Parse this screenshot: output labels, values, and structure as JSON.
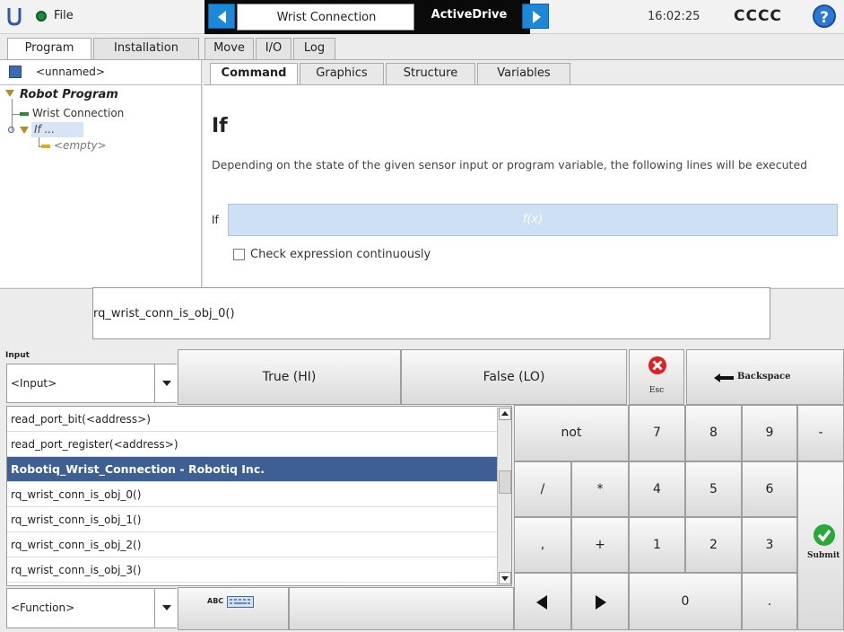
{
  "topbar": {
    "logo_icon": "ur-logo-icon",
    "file_label": "File",
    "nav_program_name": "Wrist Connection",
    "nav_active": "ActiveDrive",
    "clock": "16:02:25",
    "robot_name": "CCCC",
    "help": "?"
  },
  "main_tabs": [
    "Program",
    "Installation",
    "Move",
    "I/O",
    "Log"
  ],
  "program_tree": {
    "filename": "<unnamed>",
    "root": "Robot Program",
    "items": [
      "Wrist Connection",
      "If ...",
      "<empty>"
    ]
  },
  "sub_tabs": [
    "Command",
    "Graphics",
    "Structure",
    "Variables"
  ],
  "command": {
    "title": "If",
    "description": "Depending on the state of the given sensor input or program variable, the following lines will be executed",
    "if_label": "If",
    "if_placeholder": "f(x)",
    "check_label": "Check expression continuously"
  },
  "expression": {
    "text": "rq_wrist_conn_is_obj_0()"
  },
  "keypad": {
    "input_label": "Input",
    "input_value": "<Input>",
    "true_label": "True (HI)",
    "false_label": "False (LO)",
    "esc_label": "Esc",
    "backspace_label": "Backspace",
    "not_label": "not",
    "function_value": "<Function>",
    "abc_label": "ABC",
    "submit_label": "Submit",
    "ops": [
      "/",
      "*",
      ",",
      "+"
    ],
    "digits": [
      "7",
      "8",
      "9",
      "-",
      "4",
      "5",
      "6",
      "1",
      "2",
      "3",
      "0",
      "."
    ]
  },
  "function_list": [
    "read_port_bit(<address>)",
    "read_port_register(<address>)",
    "Robotiq_Wrist_Connection - Robotiq Inc.",
    "rq_wrist_conn_is_obj_0()",
    "rq_wrist_conn_is_obj_1()",
    "rq_wrist_conn_is_obj_2()",
    "rq_wrist_conn_is_obj_3()"
  ],
  "colors": {
    "accent": "#1e88d8",
    "selected_row": "#3d5f94",
    "if_field": "#cde0f4",
    "esc_red": "#e02020",
    "submit_green": "#2aa83a"
  }
}
